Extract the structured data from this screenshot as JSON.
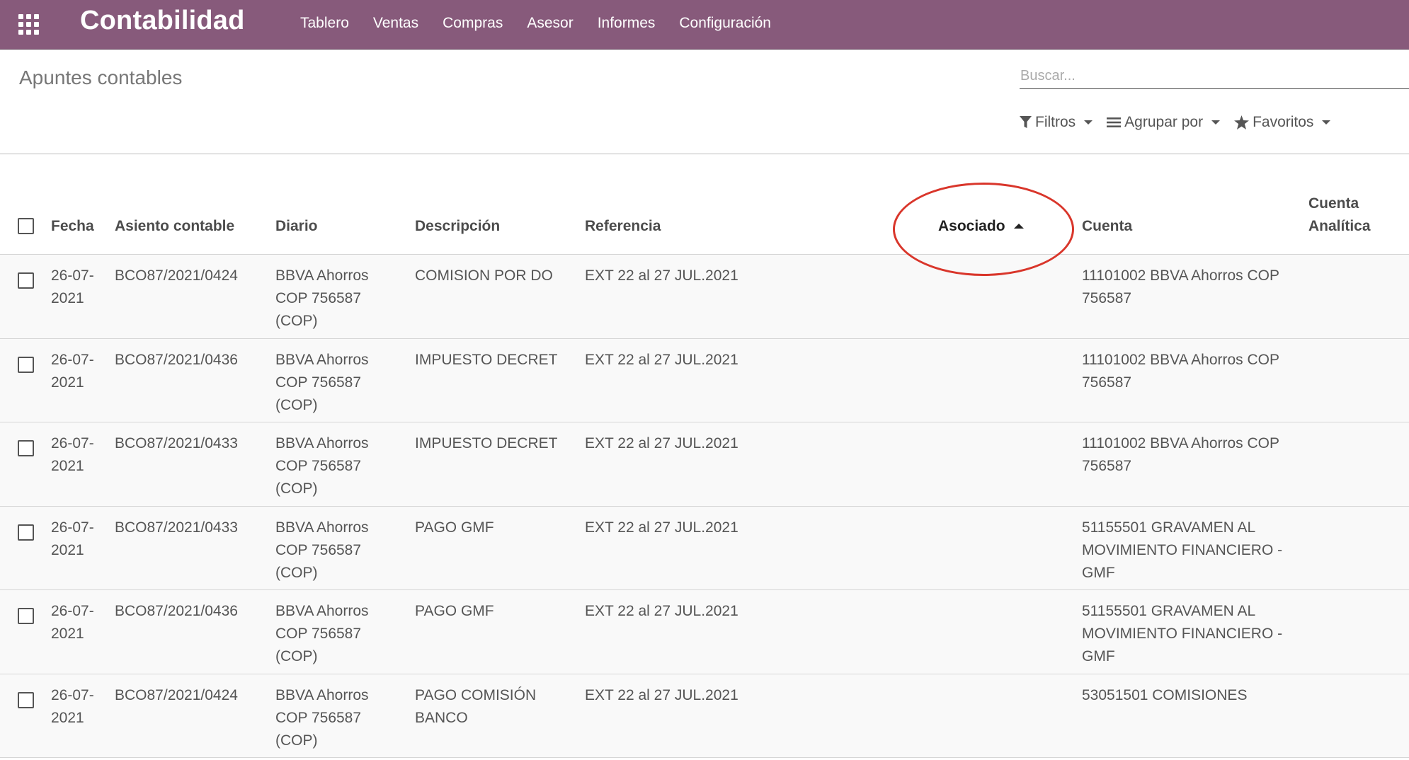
{
  "app": {
    "brand": "Contabilidad",
    "menu": [
      "Tablero",
      "Ventas",
      "Compras",
      "Asesor",
      "Informes",
      "Configuración"
    ]
  },
  "page": {
    "title": "Apuntes contables",
    "search_placeholder": "Buscar...",
    "filters_label": "Filtros",
    "groupby_label": "Agrupar por",
    "favorites_label": "Favoritos"
  },
  "table": {
    "columns": {
      "date": "Fecha",
      "entry": "Asiento contable",
      "journal": "Diario",
      "description": "Descripción",
      "reference": "Referencia",
      "partner": "Asociado",
      "account": "Cuenta",
      "analytic_line1": "Cuenta",
      "analytic_line2": "Analítica"
    },
    "sorted_column": "partner",
    "sort_direction": "asc",
    "rows": [
      {
        "date_l1": "26-07-",
        "date_l2": "2021",
        "entry": "BCO87/2021/0424",
        "journal_l1": "BBVA Ahorros",
        "journal_l2": "COP 756587",
        "journal_l3": "(COP)",
        "desc_l1": "COMISION POR DO",
        "desc_l2": "",
        "reference": "EXT 22 al 27 JUL.2021",
        "partner": "",
        "account_l1": "11101002 BBVA Ahorros COP",
        "account_l2": "756587",
        "account_l3": "",
        "analytic": ""
      },
      {
        "date_l1": "26-07-",
        "date_l2": "2021",
        "entry": "BCO87/2021/0436",
        "journal_l1": "BBVA Ahorros",
        "journal_l2": "COP 756587",
        "journal_l3": "(COP)",
        "desc_l1": "IMPUESTO DECRET",
        "desc_l2": "",
        "reference": "EXT 22 al 27 JUL.2021",
        "partner": "",
        "account_l1": "11101002 BBVA Ahorros COP",
        "account_l2": "756587",
        "account_l3": "",
        "analytic": ""
      },
      {
        "date_l1": "26-07-",
        "date_l2": "2021",
        "entry": "BCO87/2021/0433",
        "journal_l1": "BBVA Ahorros",
        "journal_l2": "COP 756587",
        "journal_l3": "(COP)",
        "desc_l1": "IMPUESTO DECRET",
        "desc_l2": "",
        "reference": "EXT 22 al 27 JUL.2021",
        "partner": "",
        "account_l1": "11101002 BBVA Ahorros COP",
        "account_l2": "756587",
        "account_l3": "",
        "analytic": ""
      },
      {
        "date_l1": "26-07-",
        "date_l2": "2021",
        "entry": "BCO87/2021/0433",
        "journal_l1": "BBVA Ahorros",
        "journal_l2": "COP 756587",
        "journal_l3": "(COP)",
        "desc_l1": "PAGO GMF",
        "desc_l2": "",
        "reference": "EXT 22 al 27 JUL.2021",
        "partner": "",
        "account_l1": "51155501 GRAVAMEN AL",
        "account_l2": "MOVIMIENTO FINANCIERO -",
        "account_l3": "GMF",
        "analytic": ""
      },
      {
        "date_l1": "26-07-",
        "date_l2": "2021",
        "entry": "BCO87/2021/0436",
        "journal_l1": "BBVA Ahorros",
        "journal_l2": "COP 756587",
        "journal_l3": "(COP)",
        "desc_l1": "PAGO GMF",
        "desc_l2": "",
        "reference": "EXT 22 al 27 JUL.2021",
        "partner": "",
        "account_l1": "51155501 GRAVAMEN AL",
        "account_l2": "MOVIMIENTO FINANCIERO -",
        "account_l3": "GMF",
        "analytic": ""
      },
      {
        "date_l1": "26-07-",
        "date_l2": "2021",
        "entry": "BCO87/2021/0424",
        "journal_l1": "BBVA Ahorros",
        "journal_l2": "COP 756587",
        "journal_l3": "(COP)",
        "desc_l1": "PAGO COMISIÓN",
        "desc_l2": "BANCO",
        "reference": "EXT 22 al 27 JUL.2021",
        "partner": "",
        "account_l1": "53051501 COMISIONES",
        "account_l2": "",
        "account_l3": "",
        "analytic": ""
      }
    ]
  },
  "colors": {
    "navbar": "#875a7b",
    "annotation_circle": "#d9362b",
    "row_background": "#f9f9f9"
  },
  "icons": {
    "apps": "apps-grid-icon",
    "filter": "filter-funnel-icon",
    "groupby": "bars-icon",
    "favorites": "star-icon",
    "sort": "caret-up-icon"
  }
}
